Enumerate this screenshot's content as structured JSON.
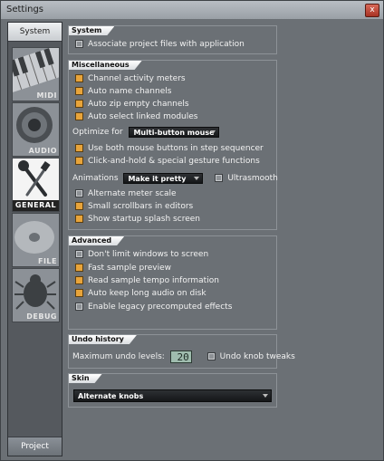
{
  "window": {
    "title": "Settings",
    "close_label": "x"
  },
  "sidebar": {
    "top_tab": "System",
    "bottom_tab": "Project",
    "items": [
      {
        "label": "MIDI",
        "icon": "piano-keys-icon"
      },
      {
        "label": "AUDIO",
        "icon": "speaker-icon"
      },
      {
        "label": "GENERAL",
        "icon": "wrench-screwdriver-icon"
      },
      {
        "label": "FILE",
        "icon": "disk-icon"
      },
      {
        "label": "DEBUG",
        "icon": "bug-icon"
      }
    ]
  },
  "system": {
    "header": "System",
    "options": [
      {
        "label": "Associate project files with application",
        "checked": false
      }
    ]
  },
  "misc": {
    "header": "Miscellaneous",
    "options": [
      {
        "label": "Channel activity meters",
        "checked": true
      },
      {
        "label": "Auto name channels",
        "checked": true
      },
      {
        "label": "Auto zip empty channels",
        "checked": true
      },
      {
        "label": "Auto select linked modules",
        "checked": true
      }
    ],
    "optimize_label": "Optimize for",
    "optimize_value": "Multi-button mouse",
    "options2": [
      {
        "label": "Use both mouse buttons in step sequencer",
        "checked": true
      },
      {
        "label": "Click-and-hold & special gesture functions",
        "checked": true
      }
    ],
    "animations_label": "Animations",
    "animations_value": "Make it pretty",
    "ultrasmooth_label": "Ultrasmooth",
    "options3": [
      {
        "label": "Alternate meter scale",
        "checked": false
      },
      {
        "label": "Small scrollbars in editors",
        "checked": true
      },
      {
        "label": "Show startup splash screen",
        "checked": true
      }
    ]
  },
  "advanced": {
    "header": "Advanced",
    "options": [
      {
        "label": "Don't limit windows to screen",
        "checked": false
      },
      {
        "label": "Fast sample preview",
        "checked": true
      },
      {
        "label": "Read sample tempo information",
        "checked": true
      },
      {
        "label": "Auto keep long audio on disk",
        "checked": true
      },
      {
        "label": "Enable legacy precomputed effects",
        "checked": false
      }
    ]
  },
  "undo": {
    "header": "Undo history",
    "max_label": "Maximum undo levels:",
    "max_value": "20",
    "knob_label": "Undo knob tweaks"
  },
  "skin": {
    "header": "Skin",
    "value": "Alternate knobs"
  }
}
